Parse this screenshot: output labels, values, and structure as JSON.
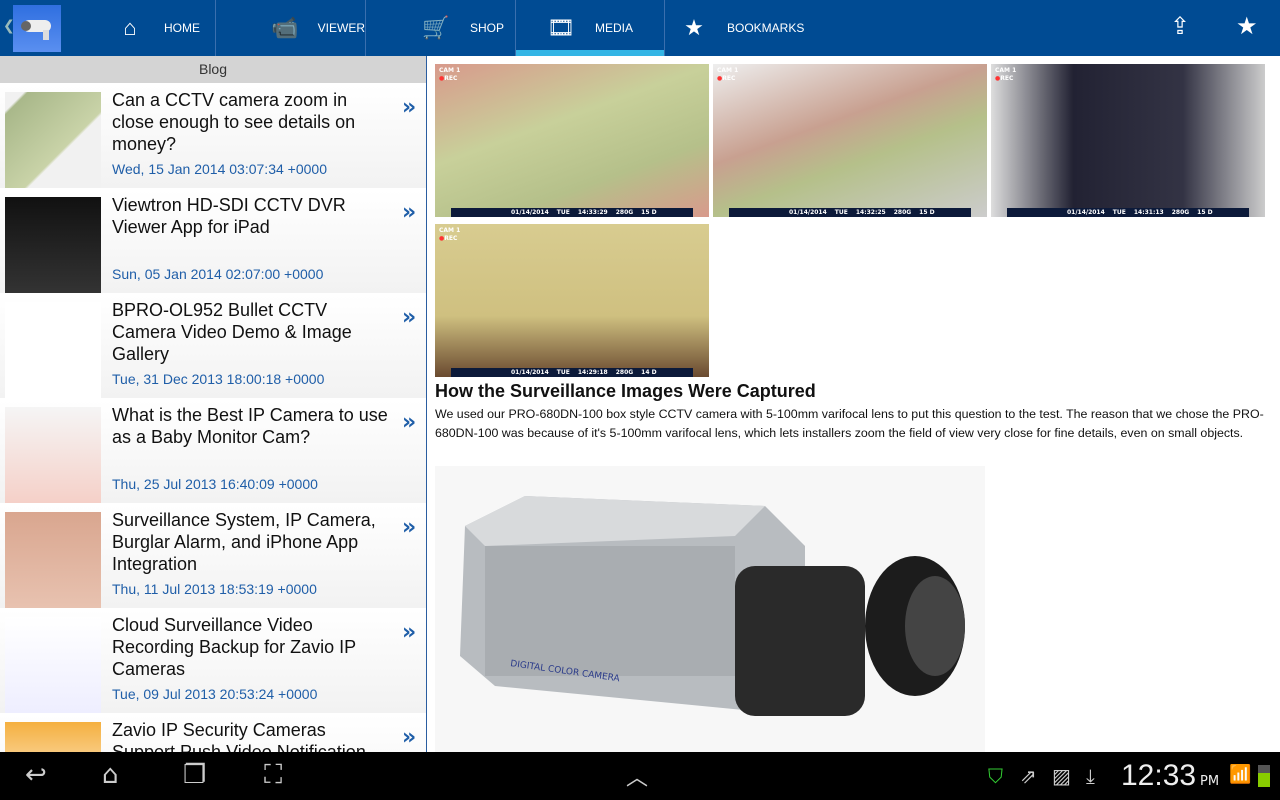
{
  "nav": {
    "tabs": [
      {
        "label": "HOME",
        "icon": "home-icon"
      },
      {
        "label": "VIEWER",
        "icon": "cctv-icon"
      },
      {
        "label": "SHOP",
        "icon": "cart-icon"
      },
      {
        "label": "MEDIA",
        "icon": "film-icon"
      },
      {
        "label": "BOOKMARKS",
        "icon": "star-icon"
      }
    ],
    "active": "MEDIA"
  },
  "sidebar": {
    "header": "Blog",
    "items": [
      {
        "title": "Can a CCTV camera zoom in close enough to see details on money?",
        "date": "Wed, 15 Jan 2014 03:07:34 +0000"
      },
      {
        "title": "Viewtron HD-SDI CCTV DVR Viewer App for iPad",
        "date": "Sun, 05 Jan 2014 02:07:00 +0000"
      },
      {
        "title": "BPRO-OL952 Bullet CCTV Camera Video Demo & Image Gallery",
        "date": "Tue, 31 Dec 2013 18:00:18 +0000"
      },
      {
        "title": "What is the Best IP Camera to use as a Baby Monitor Cam?",
        "date": "Thu, 25 Jul 2013 16:40:09 +0000"
      },
      {
        "title": "Surveillance System, IP Camera, Burglar Alarm, and iPhone App Integration",
        "date": "Thu, 11 Jul 2013 18:53:19 +0000"
      },
      {
        "title": "Cloud Surveillance Video Recording Backup for Zavio IP Cameras",
        "date": "Tue, 09 Jul 2013 20:53:24 +0000"
      },
      {
        "title": "Zavio IP Security Cameras Support Push Video Notification",
        "date": ""
      }
    ]
  },
  "article": {
    "cams": [
      {
        "cam": "CAM 1",
        "rec": "REC",
        "date": "01/14/2014",
        "day": "TUE",
        "time": "14:33:29",
        "disk": "280G",
        "days": "15 D"
      },
      {
        "cam": "CAM 1",
        "rec": "REC",
        "date": "01/14/2014",
        "day": "TUE",
        "time": "14:32:25",
        "disk": "280G",
        "days": "15 D"
      },
      {
        "cam": "CAM 1",
        "rec": "REC",
        "date": "01/14/2014",
        "day": "TUE",
        "time": "14:31:13",
        "disk": "280G",
        "days": "15 D"
      },
      {
        "cam": "CAM 1",
        "rec": "REC",
        "date": "01/14/2014",
        "day": "TUE",
        "time": "14:29:18",
        "disk": "280G",
        "days": "14 D"
      }
    ],
    "heading": "How the Surveillance Images Were Captured",
    "body": "We used our PRO-680DN-100 box style CCTV camera with 5-100mm varifocal lens to put this question to the test. The reason that we chose the PRO-680DN-100 was because of it's 5-100mm varifocal lens, which lets installers zoom the field of view very close for fine details, even on small objects.",
    "product_label": "DIGITAL COLOR CAMERA"
  },
  "status": {
    "time": "12:33",
    "ampm": "PM"
  },
  "colors": {
    "topbar": "#004b93",
    "accent": "#33b5e5",
    "link": "#1f5ea8"
  }
}
